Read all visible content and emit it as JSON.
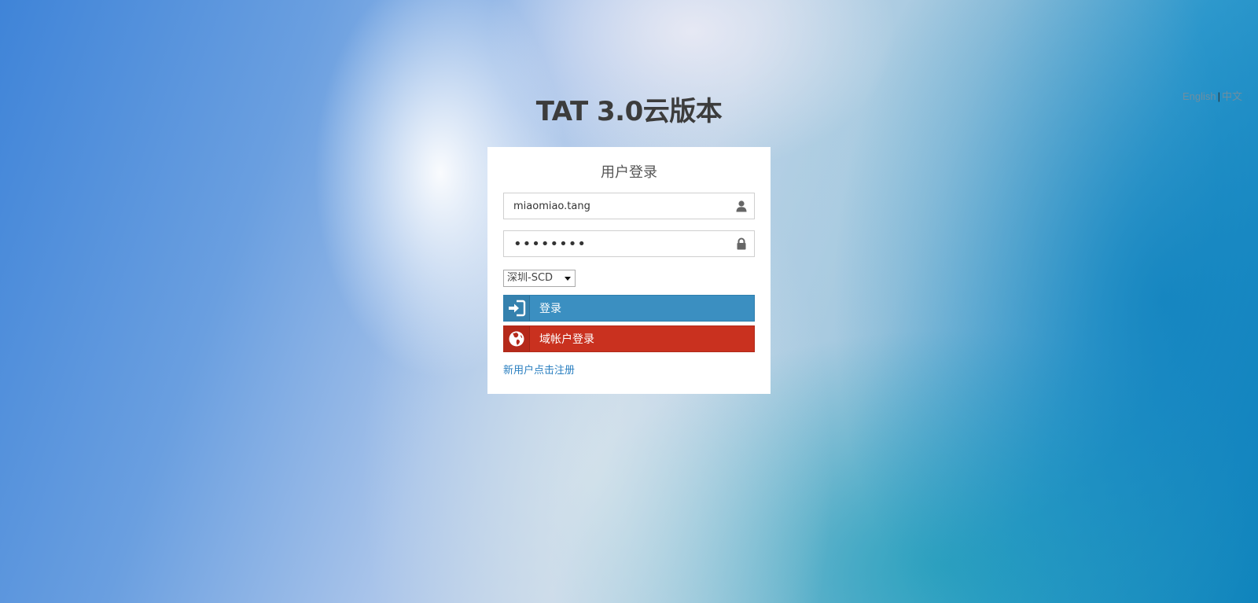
{
  "language_switch": {
    "english_label": "English",
    "separator": "|",
    "chinese_label": "中文"
  },
  "app_title": "TAT 3.0云版本",
  "login": {
    "heading": "用户登录",
    "username_value": "miaomiao.tang",
    "password_value": "••••••••",
    "region_selected": "深圳-SCD",
    "login_button_label": "登录",
    "domain_login_button_label": "域帐户登录",
    "register_link_label": "新用户点击注册"
  },
  "icons": {
    "username": "user-icon",
    "password": "lock-icon",
    "login": "sign-in-icon",
    "domain": "globe-icon"
  },
  "colors": {
    "login_button": "#3b8fc1",
    "domain_button": "#c9311f",
    "link": "#2a7fc0"
  }
}
